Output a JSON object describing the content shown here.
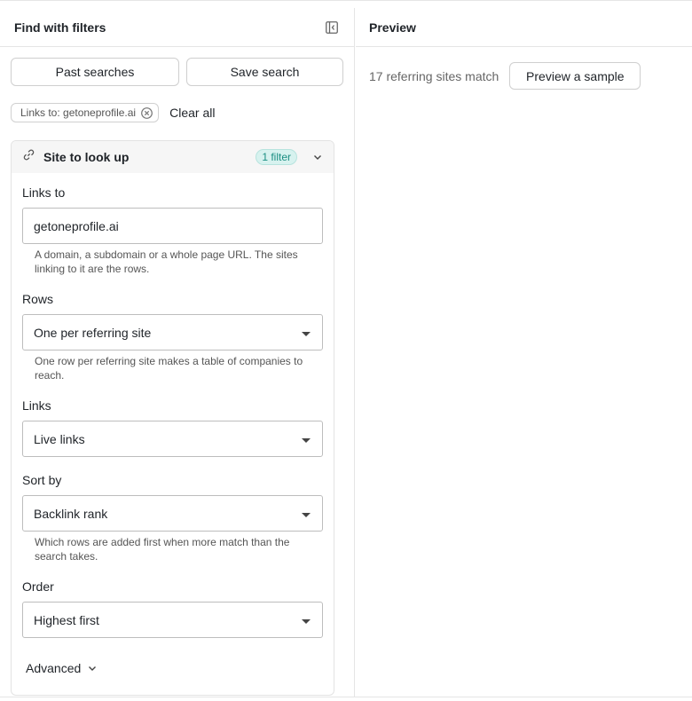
{
  "left_panel": {
    "title": "Find with filters",
    "past_searches_label": "Past searches",
    "save_search_label": "Save search",
    "active_filter_chip": "Links to: getoneprofile.ai",
    "clear_all_label": "Clear all",
    "section": {
      "title": "Site to look up",
      "badge": "1 filter",
      "fields": {
        "links_to": {
          "label": "Links to",
          "value": "getoneprofile.ai",
          "help": "A domain, a subdomain or a whole page URL. The sites linking to it are the rows."
        },
        "rows": {
          "label": "Rows",
          "value": "One per referring site",
          "help": "One row per referring site makes a table of companies to reach."
        },
        "links": {
          "label": "Links",
          "value": "Live links"
        },
        "sort_by": {
          "label": "Sort by",
          "value": "Backlink rank",
          "help": "Which rows are added first when more match than the search takes."
        },
        "order": {
          "label": "Order",
          "value": "Highest first"
        }
      },
      "advanced_label": "Advanced"
    }
  },
  "right_panel": {
    "title": "Preview",
    "match_count_text": "17 referring sites match",
    "preview_button_label": "Preview a sample"
  },
  "colors": {
    "badge_bg": "#d7f2ef",
    "badge_text": "#1b8e82",
    "border": "#e5e5e5"
  }
}
